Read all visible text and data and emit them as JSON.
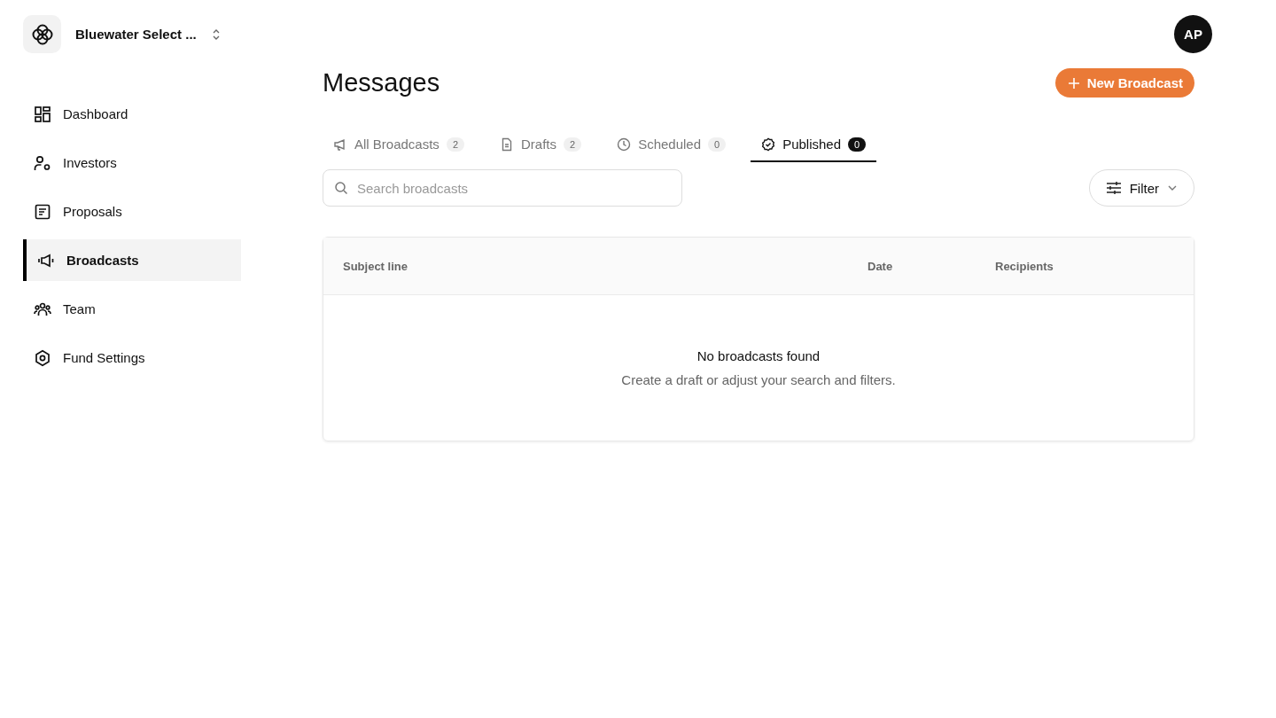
{
  "workspace": {
    "name": "Bluewater Select ..."
  },
  "sidebar": {
    "items": [
      {
        "label": "Dashboard",
        "selected": false
      },
      {
        "label": "Investors",
        "selected": false
      },
      {
        "label": "Proposals",
        "selected": false
      },
      {
        "label": "Broadcasts",
        "selected": true
      },
      {
        "label": "Team",
        "selected": false
      },
      {
        "label": "Fund Settings",
        "selected": false
      }
    ]
  },
  "user": {
    "initials": "AP"
  },
  "page": {
    "title": "Messages",
    "action": "New Broadcast"
  },
  "tabs": [
    {
      "label": "All Broadcasts",
      "count": "2",
      "selected": false
    },
    {
      "label": "Drafts",
      "count": "2",
      "selected": false
    },
    {
      "label": "Scheduled",
      "count": "0",
      "selected": false
    },
    {
      "label": "Published",
      "count": "0",
      "selected": true
    }
  ],
  "search": {
    "placeholder": "Search broadcasts"
  },
  "filter": {
    "label": "Filter"
  },
  "table": {
    "columns": [
      "Subject line",
      "Date",
      "Recipients"
    ],
    "empty": {
      "title": "No broadcasts found",
      "text": "Create a draft or adjust your search and filters."
    }
  }
}
